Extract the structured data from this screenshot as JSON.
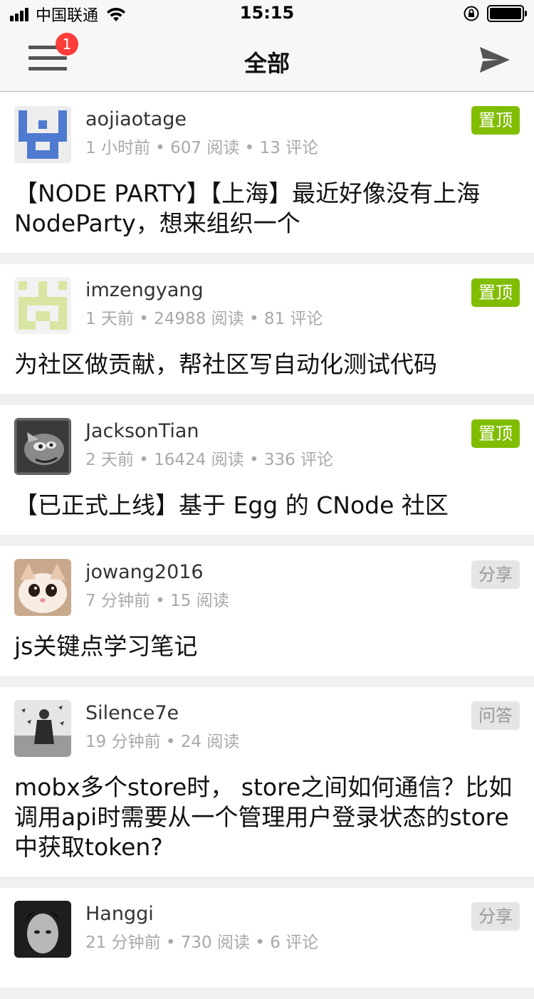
{
  "status_bar": {
    "carrier": "中国联通",
    "time": "15:15"
  },
  "nav": {
    "title": "全部",
    "badge": "1",
    "menu_icon": "hamburger-menu-icon",
    "send_icon": "paper-plane-icon"
  },
  "colors": {
    "accent": "#80bd01",
    "badge": "#fc3d39",
    "meta": "#a8a8a8"
  },
  "topics": [
    {
      "author": "aojiaotage",
      "time": "1 小时前",
      "reads": "607 阅读",
      "comments": "13 评论",
      "tag": "置顶",
      "title": "【NODE PARTY】【上海】最近好像没有上海NodeParty，想来组织一个"
    },
    {
      "author": "imzengyang",
      "time": "1 天前",
      "reads": "24988 阅读",
      "comments": "81 评论",
      "tag": "置顶",
      "title": "为社区做贡献，帮社区写自动化测试代码"
    },
    {
      "author": "JacksonTian",
      "time": "2 天前",
      "reads": "16424 阅读",
      "comments": "336 评论",
      "tag": "置顶",
      "title": "【已正式上线】基于 Egg 的 CNode 社区"
    },
    {
      "author": "jowang2016",
      "time": "7 分钟前",
      "reads": "15 阅读",
      "tag": "分享",
      "title": "js关键点学习笔记"
    },
    {
      "author": "Silence7e",
      "time": "19 分钟前",
      "reads": "24 阅读",
      "tag": "问答",
      "title": "mobx多个store时， store之间如何通信？比如调用api时需要从一个管理用户登录状态的store中获取token?"
    },
    {
      "author": "Hanggi",
      "time": "21 分钟前",
      "reads": "730 阅读",
      "comments": "6 评论",
      "tag": "分享",
      "title": ""
    }
  ]
}
